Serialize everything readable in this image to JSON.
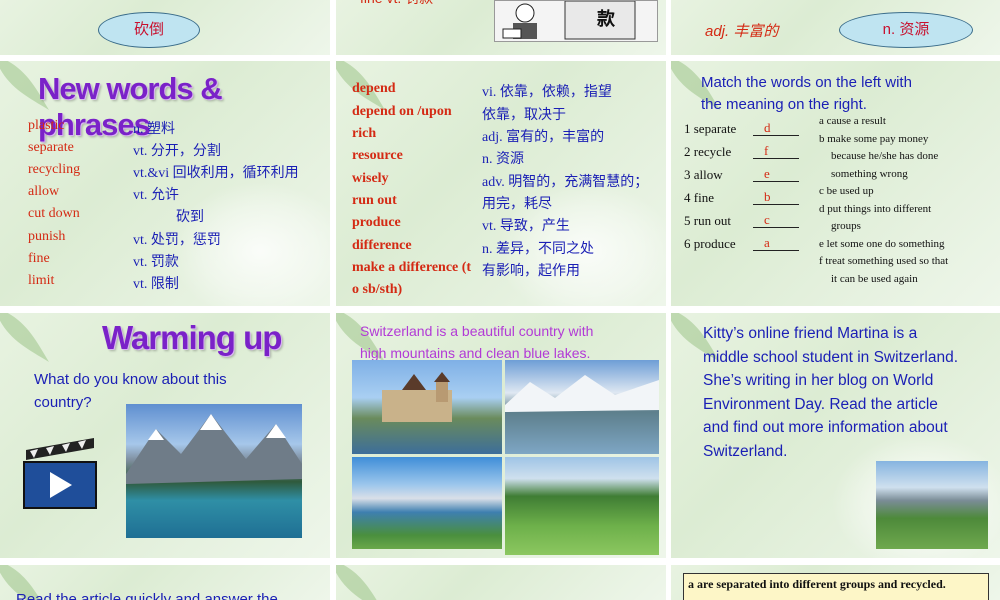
{
  "row0": {
    "left_oval": "砍倒",
    "mid_partial": "fine vt. 罚款",
    "mid_image_caption": "款",
    "right_oval_a": "adj. 丰富的",
    "right_oval_b": "n. 资源"
  },
  "new_words": {
    "title": "New words & phrases",
    "items": [
      {
        "word": "plastic",
        "meaning": "n. 塑料"
      },
      {
        "word": "separate",
        "meaning": "vt. 分开，分割"
      },
      {
        "word": "recycling",
        "meaning": "vt.&vi 回收利用，循环利用"
      },
      {
        "word": "allow",
        "meaning": "vt. 允许"
      },
      {
        "word": "cut down",
        "meaning": "砍到"
      },
      {
        "word": "punish",
        "meaning": "vt. 处罚，惩罚"
      },
      {
        "word": "fine",
        "meaning": "vt. 罚款"
      },
      {
        "word": "limit",
        "meaning": "vt. 限制"
      }
    ]
  },
  "vocab2": {
    "items": [
      {
        "word": "depend",
        "meaning": "vi. 依靠，依赖，指望"
      },
      {
        "word": "depend on /upon",
        "meaning": "依靠，取决于"
      },
      {
        "word": "rich",
        "meaning": "adj. 富有的，丰富的"
      },
      {
        "word": "resource",
        "meaning": "n. 资源"
      },
      {
        "word": "wisely",
        "meaning": "adv. 明智的，充满智慧的；"
      },
      {
        "word": "run out",
        "meaning": "用完，耗尽"
      },
      {
        "word": "produce",
        "meaning": "vt. 导致，产生"
      },
      {
        "word": "difference",
        "meaning": "n. 差异，不同之处"
      },
      {
        "word": "make a difference (t",
        "meaning": "有影响，起作用"
      },
      {
        "word": "o sb/sth)",
        "meaning": ""
      }
    ]
  },
  "match": {
    "instruction_line1": "Match the words on the left with",
    "instruction_line2": "the meaning on the right.",
    "left": [
      {
        "word": "1 separate",
        "answer": "d"
      },
      {
        "word": "2 recycle",
        "answer": "f"
      },
      {
        "word": "3 allow",
        "answer": "e"
      },
      {
        "word": "4 fine",
        "answer": "b"
      },
      {
        "word": "5 run out",
        "answer": "c"
      },
      {
        "word": "6 produce",
        "answer": "a"
      }
    ],
    "right": [
      "a cause a result",
      "b make some pay money",
      "because he/she has done",
      "something wrong",
      "c be used up",
      "d put things into different",
      "groups",
      "e let some one do something",
      "f treat something used so that",
      "it can be used again"
    ]
  },
  "warming": {
    "title": "Warming up",
    "question_line1": "What do you know about this",
    "question_line2": "country?"
  },
  "switzerland": {
    "caption_line1": "Switzerland is a beautiful country with",
    "caption_line2": "high mountains and clean blue lakes."
  },
  "kitty": {
    "lines": [
      "Kitty’s online friend Martina is a",
      "middle school student in Switzerland.",
      "She’s writing in her blog on World",
      "Environment Day. Read the article",
      "and find out more information about",
      "Switzerland."
    ]
  },
  "row3": {
    "left_partial": "Read the article quickly and answer the",
    "right_box": "a are separated into different groups and recycled."
  },
  "colors": {
    "title_purple": "#7a22c8",
    "word_red": "#d42a14",
    "meaning_blue": "#1a1fb5",
    "slide_bg": "#dcecd3"
  }
}
